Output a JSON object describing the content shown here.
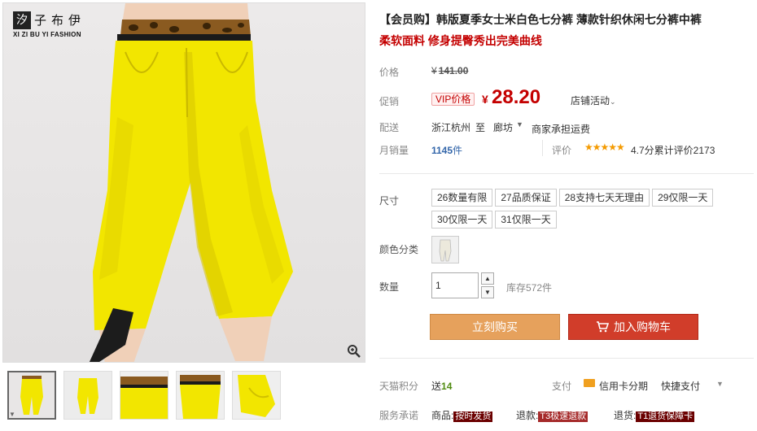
{
  "brand": {
    "mark": "汐",
    "name_cn": "子布伊",
    "name_en": "XI ZI BU YI FASHION"
  },
  "product": {
    "title": "【会员购】韩版夏季女士米白色七分裤 薄款针织休闲七分裤中裤",
    "subtitle": "柔软面料 修身提臀秀出完美曲线"
  },
  "price": {
    "label": "价格",
    "currency": "¥",
    "original": "141.00",
    "promo_label": "促销",
    "vip_label": "VIP价格",
    "vip_value": "28.20",
    "store_activity": "店铺活动"
  },
  "shipping": {
    "label": "配送",
    "from": "浙江杭州",
    "to": "至",
    "city": "廊坊",
    "fee": "商家承担运费"
  },
  "sales": {
    "label": "月销量",
    "count": "1145",
    "unit": "件",
    "review_label": "评价",
    "stars": "★★★★★",
    "review_summary": "4.7分累计评价2173"
  },
  "sizes": {
    "label": "尺寸",
    "options": [
      "26数量有限",
      "27品质保证",
      "28支持七天无理由",
      "29仅限一天",
      "30仅限一天",
      "31仅限一天"
    ]
  },
  "color": {
    "label": "颜色分类"
  },
  "quantity": {
    "label": "数量",
    "value": "1",
    "stock": "库存572件"
  },
  "buttons": {
    "buy": "立刻购买",
    "cart": "加入购物车"
  },
  "points": {
    "label": "天猫积分",
    "prefix": "送",
    "value": "14"
  },
  "payment": {
    "label": "支付",
    "card": "信用卡分期",
    "quick": "快捷支付"
  },
  "service": {
    "label": "服务承诺",
    "items": [
      {
        "prefix": "商品:",
        "tag": "按时发货"
      },
      {
        "prefix": "退款:",
        "tag": "T3极速退款"
      },
      {
        "prefix": "退货:",
        "tag": "T1退货保障卡"
      }
    ]
  },
  "colors": {
    "price_red": "#c40000",
    "buy_btn": "#e6a15c",
    "cart_btn": "#d13d2a",
    "pants_yellow": "#f2e600"
  }
}
